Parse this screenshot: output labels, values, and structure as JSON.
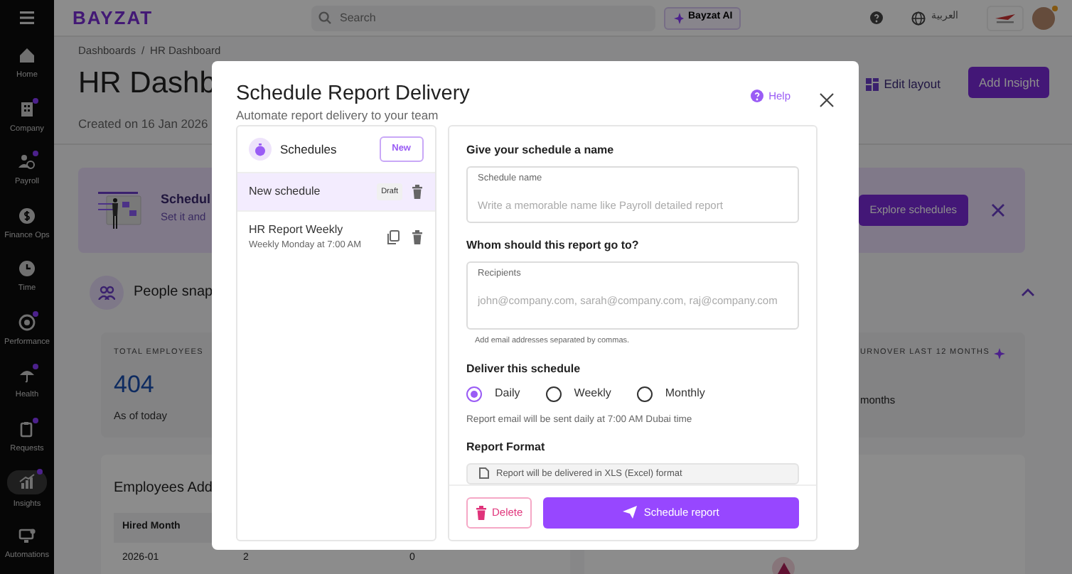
{
  "sidebar": {
    "items": [
      {
        "label": "Home",
        "dot": false,
        "selected": false
      },
      {
        "label": "Company",
        "dot": true,
        "selected": false
      },
      {
        "label": "Payroll",
        "dot": true,
        "selected": false
      },
      {
        "label": "Finance Ops",
        "dot": false,
        "selected": false
      },
      {
        "label": "Time",
        "dot": false,
        "selected": false
      },
      {
        "label": "Performance",
        "dot": true,
        "selected": false
      },
      {
        "label": "Health",
        "dot": true,
        "selected": false
      },
      {
        "label": "Requests",
        "dot": true,
        "selected": false
      },
      {
        "label": "Insights",
        "dot": true,
        "selected": true
      },
      {
        "label": "Automations",
        "dot": false,
        "selected": false
      }
    ]
  },
  "topbar": {
    "logo": "BAYZAT",
    "search": {
      "placeholder": "Search"
    },
    "ai_button": "Bayzat AI",
    "language": "العربية"
  },
  "page": {
    "breadcrumb": [
      "Dashboards",
      "HR Dashboard"
    ],
    "breadcrumb_separator": "/",
    "title": "HR Dashb",
    "created": "Created on 16 Jan 2026",
    "edit_layout": "Edit layout",
    "add_insight": "Add Insight",
    "banner": {
      "title": "Schedul",
      "text": "Set it and",
      "button": "Explore schedules"
    },
    "section": {
      "title": "People snap"
    },
    "total_card": {
      "label": "TOTAL EMPLOYEES",
      "value": "404",
      "note": "As of today"
    },
    "turnover_card": {
      "label": "URNOVER LAST 12 MONTHS",
      "note": "months"
    },
    "table": {
      "title": "Employees Add",
      "columns": [
        "Hired Month"
      ],
      "rows": [
        [
          "2026-01",
          "2",
          "0"
        ]
      ]
    }
  },
  "modal": {
    "title": "Schedule Report Delivery",
    "subtitle": "Automate report delivery to your team",
    "help": "Help",
    "schedules": {
      "title": "Schedules",
      "new_button": "New",
      "items": [
        {
          "name": "New schedule",
          "badge": "Draft",
          "selected": true
        },
        {
          "name": "HR Report Weekly",
          "detail": "Weekly Monday at 7:00 AM",
          "selected": false
        }
      ]
    },
    "form": {
      "name_label": "Give your schedule a name",
      "name_field": {
        "label": "Schedule name",
        "placeholder": "Write a memorable name like Payroll detailed report"
      },
      "recipients_label": "Whom should this report go to?",
      "recipients_field": {
        "label": "Recipients",
        "placeholder": "john@company.com, sarah@company.com, raj@company.com"
      },
      "recipients_hint": "Add email addresses separated by commas.",
      "deliver_label": "Deliver this schedule",
      "options": [
        {
          "label": "Daily",
          "selected": true
        },
        {
          "label": "Weekly",
          "selected": false
        },
        {
          "label": "Monthly",
          "selected": false
        }
      ],
      "deliver_note": "Report email will be sent daily at 7:00 AM Dubai time",
      "format_label": "Report Format",
      "format_note": "Report will be delivered in XLS (Excel) format"
    },
    "delete_button": "Delete",
    "submit_button": "Schedule report"
  }
}
